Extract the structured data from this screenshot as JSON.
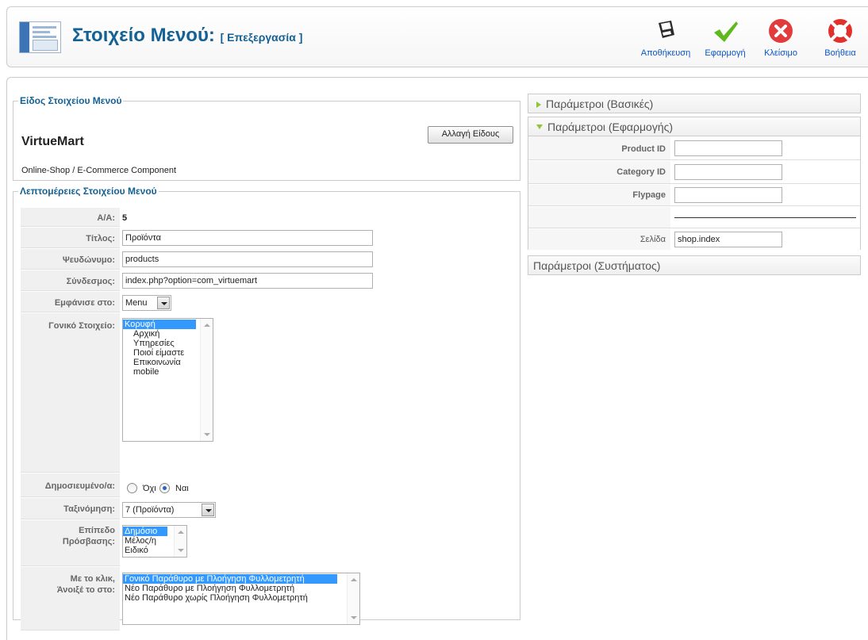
{
  "header": {
    "title": "Στοιχείο Μενού:",
    "subtitle": "[ Επεξεργασία ]",
    "toolbar": [
      {
        "label": "Αποθήκευση",
        "icon": "save-icon"
      },
      {
        "label": "Εφαρμογή",
        "icon": "apply-checkmark-icon"
      },
      {
        "label": "Κλείσιμο",
        "icon": "close-icon"
      },
      {
        "label": "Βοήθεια",
        "icon": "help-lifebuoy-icon"
      }
    ]
  },
  "menu_type": {
    "legend": "Είδος Στοιχείου Μενού",
    "name": "VirtueMart",
    "description": "Online-Shop / E-Commerce Component",
    "change_button": "Αλλαγή Είδους"
  },
  "details": {
    "legend": "Λεπτομέρειες Στοιχείου Μενού",
    "id_label": "Α/Α:",
    "id_value": "5",
    "title_label": "Τίτλος:",
    "title_value": "Προϊόντα",
    "alias_label": "Ψευδώνυμο:",
    "alias_value": "products",
    "link_label": "Σύνδεσμος:",
    "link_value": "index.php?option=com_virtuemart",
    "display_in_label": "Εμφάνισε στο:",
    "display_in_value": "Menu",
    "parent_label": "Γονικό Στοιχείο:",
    "parent_options": [
      "Κορυφή",
      "Αρχική",
      "Υπηρεσίες",
      "Ποιοί είμαστε",
      "Επικοινωνία",
      "mobile"
    ],
    "parent_selected": "Κορυφή",
    "published_label": "Δημοσιευμένο/α:",
    "published_no": "Όχι",
    "published_yes": "Ναι",
    "published_value": "Ναι",
    "ordering_label": "Ταξινόμηση:",
    "ordering_value": "7 (Προϊόντα)",
    "access_label_1": "Επίπεδο",
    "access_label_2": "Πρόσβασης:",
    "access_options": [
      "Δημόσιο",
      "Μέλος/η",
      "Ειδικό"
    ],
    "access_selected": "Δημόσιο",
    "target_label_1": "Με το κλικ,",
    "target_label_2": "Άνοιξέ το στο:",
    "target_options": [
      "Γονικό Παράθυρο με Πλοήγηση Φυλλομετρητή",
      "Νέο Παράθυρο με Πλοήγηση Φυλλομετρητή",
      "Νέο Παράθυρο χωρίς Πλοήγηση Φυλλομετρητή"
    ],
    "target_selected": "Γονικό Παράθυρο με Πλοήγηση Φυλλομετρητή"
  },
  "params": {
    "basic_title": "Παράμετροι (Βασικές)",
    "app_title": "Παράμετροι (Εφαρμογής)",
    "product_id_label": "Product ID",
    "product_id_value": "",
    "category_id_label": "Category ID",
    "category_id_value": "",
    "flypage_label": "Flypage",
    "flypage_value": "",
    "page_label": "Σελίδα",
    "page_value": "shop.index",
    "system_title": "Παράμετροι (Συστήματος)"
  },
  "colors": {
    "title_blue": "#146295",
    "link_blue": "#0b55c4",
    "selected_blue": "#3399ff",
    "panel_arrow_green": "#8fc43b"
  }
}
